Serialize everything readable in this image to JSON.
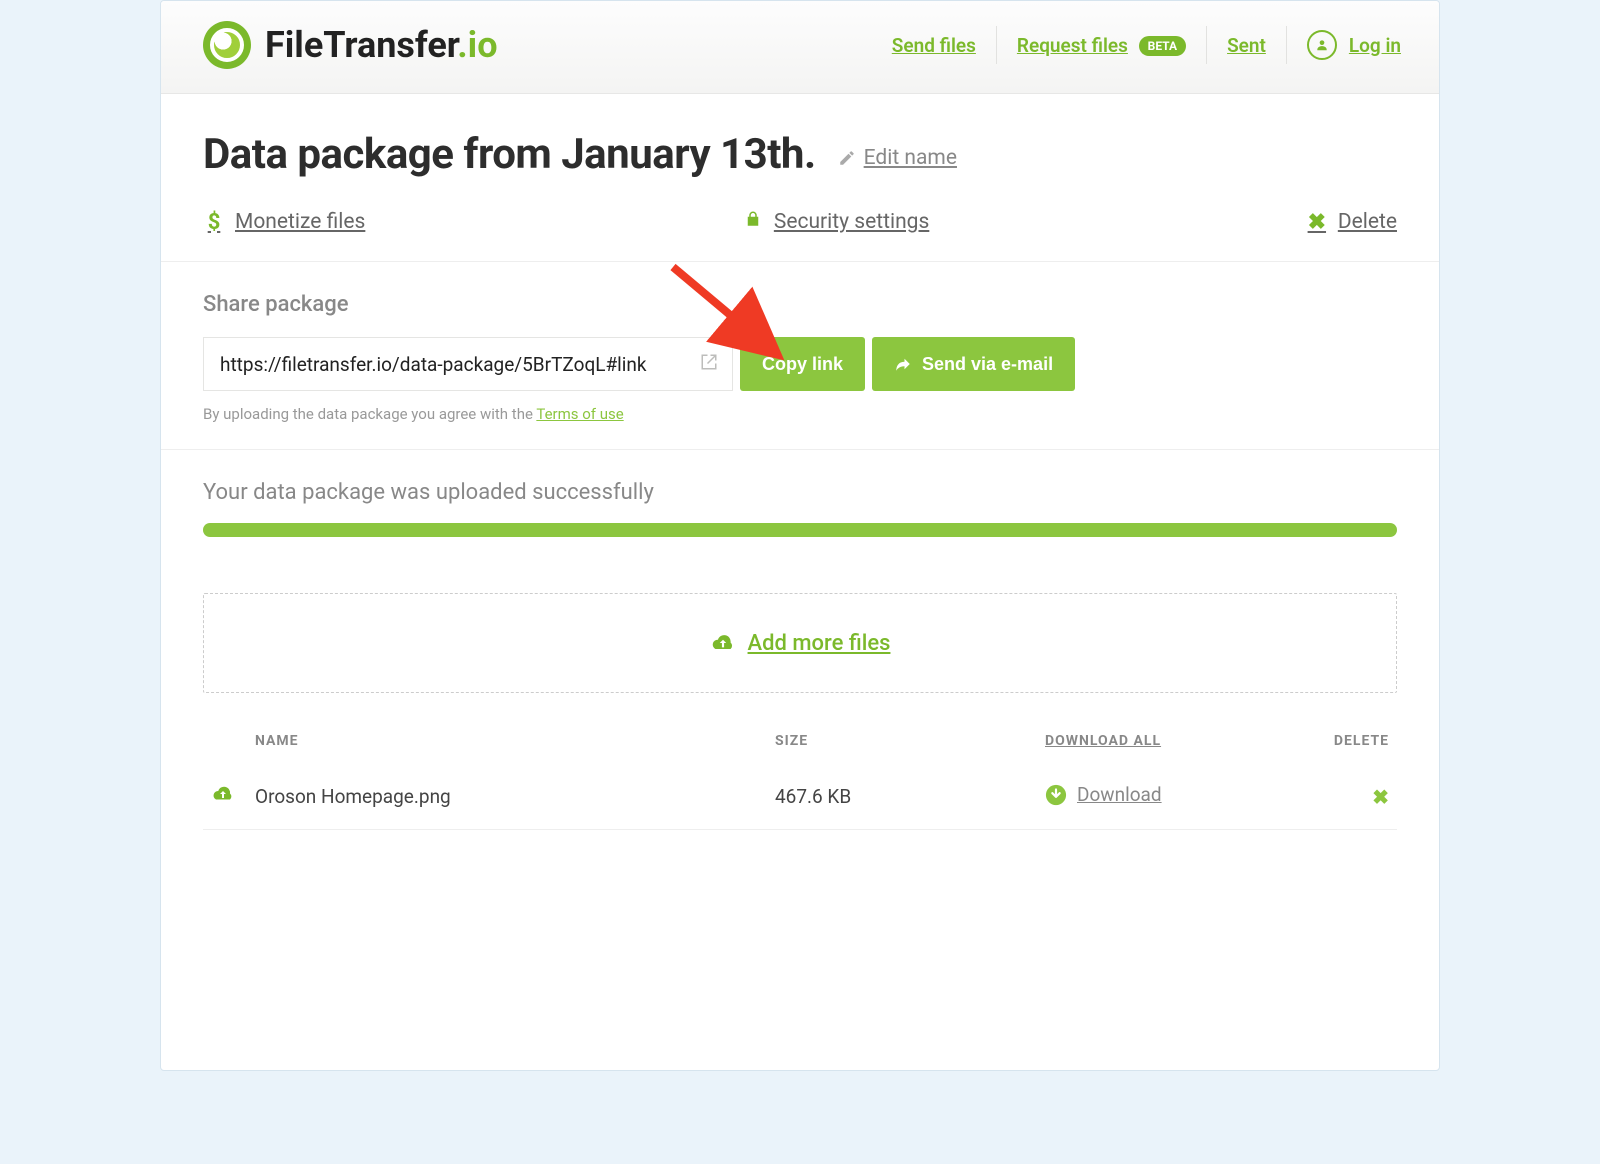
{
  "brand": {
    "name": "FileTransfer",
    "tld": ".io"
  },
  "nav": {
    "send": "Send files",
    "request": "Request files",
    "badge": "BETA",
    "sent": "Sent",
    "login": "Log in"
  },
  "page": {
    "title": "Data package from January 13th.",
    "edit": "Edit name"
  },
  "actions": {
    "monetize": "Monetize files",
    "security": "Security settings",
    "delete": "Delete"
  },
  "share": {
    "title": "Share package",
    "url": "https://filetransfer.io/data-package/5BrTZoqL#link",
    "copy": "Copy link",
    "email": "Send via e-mail",
    "terms_prefix": "By uploading the data package you agree with the ",
    "terms_link": "Terms of use"
  },
  "upload": {
    "success": "Your data package was uploaded successfully",
    "add_more": "Add more files"
  },
  "table": {
    "headers": {
      "name": "NAME",
      "size": "SIZE",
      "download_all": "DOWNLOAD ALL",
      "delete": "DELETE"
    },
    "download_label": "Download",
    "rows": [
      {
        "name": "Oroson Homepage.png",
        "size": "467.6 KB"
      }
    ]
  }
}
